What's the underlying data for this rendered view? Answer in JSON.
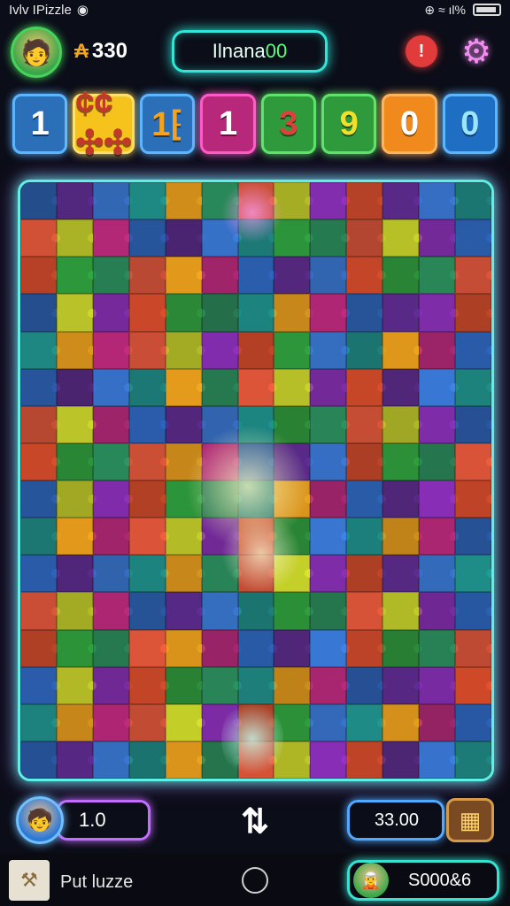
{
  "status_bar": {
    "app_name": "Ivlv IPizzle",
    "indicators": "⊕ ≈ ıl%"
  },
  "header": {
    "coins": "330",
    "title_main": "Ilnana",
    "title_accent": "00",
    "alert_label": "!",
    "settings_icon": "gear-icon"
  },
  "tiles": [
    {
      "text": "1",
      "bg": "#2a6fb8",
      "border": "#5bb6ff",
      "color": "#ffffff"
    },
    {
      "text": "¢¢ ✣✣",
      "bg": "#f6c21c",
      "border": "#ffe06a",
      "color": "#c0392b"
    },
    {
      "text": "1⁅",
      "bg": "#2a6fb8",
      "border": "#5bb6ff",
      "color": "#f6a21c"
    },
    {
      "text": "1",
      "bg": "#b8287a",
      "border": "#ff5ac8",
      "color": "#ffffff"
    },
    {
      "text": "3",
      "bg": "#2e9a3c",
      "border": "#5fe36a",
      "color": "#e0403c"
    },
    {
      "text": "9",
      "bg": "#2e9a3c",
      "border": "#5fe36a",
      "color": "#f0e02a"
    },
    {
      "text": "0",
      "bg": "#f08a1c",
      "border": "#ffb45a",
      "color": "#ffffff"
    },
    {
      "text": "0",
      "bg": "#1e6fc4",
      "border": "#5bb6ff",
      "color": "#9ae6ff"
    }
  ],
  "board": {
    "columns": 13,
    "rows": 16,
    "palette": [
      "#2b5fb0",
      "#2e9a3c",
      "#b8287a",
      "#d24a2a",
      "#f0a21c",
      "#8a2fb8",
      "#1f8f8a",
      "#c8d22a",
      "#3a7ad8",
      "#e0563a",
      "#5a2a8a",
      "#2a8a5a"
    ]
  },
  "bottom": {
    "level_value": "1.0",
    "swap_icon": "swap-arrows-icon",
    "score_value": "33.00",
    "chest_icon": "chest-icon"
  },
  "navbar": {
    "label": "Put luzze",
    "user_value": "S000&6"
  }
}
